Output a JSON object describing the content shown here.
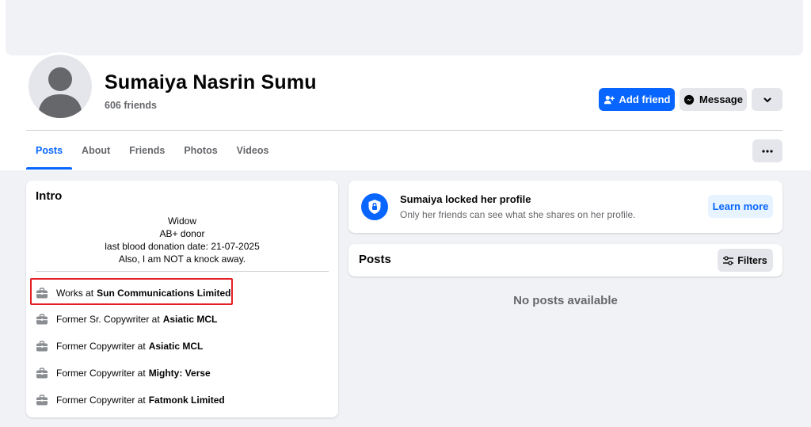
{
  "profile": {
    "name": "Sumaiya Nasrin Sumu",
    "friends": "606 friends"
  },
  "actions": {
    "add_friend": "Add friend",
    "message": "Message"
  },
  "tabs": [
    {
      "label": "Posts",
      "active": true
    },
    {
      "label": "About"
    },
    {
      "label": "Friends"
    },
    {
      "label": "Photos"
    },
    {
      "label": "Videos"
    }
  ],
  "intro": {
    "title": "Intro",
    "bio": [
      "Widow",
      "AB+ donor",
      "last blood donation date: 21-07-2025",
      "Also, I am NOT a knock away."
    ],
    "work": [
      {
        "prefix": "Works at",
        "org": "Sun Communications Limited"
      },
      {
        "prefix": "Former Sr. Copywriter at",
        "org": "Asiatic MCL"
      },
      {
        "prefix": "Former Copywriter at",
        "org": "Asiatic MCL"
      },
      {
        "prefix": "Former Copywriter at",
        "org": "Mighty: Verse"
      },
      {
        "prefix": "Former Copywriter at",
        "org": "Fatmonk Limited"
      }
    ]
  },
  "locked": {
    "title": "Sumaiya locked her profile",
    "subtitle": "Only her friends can see what she shares on her profile.",
    "learn_more": "Learn more"
  },
  "posts": {
    "title": "Posts",
    "filters": "Filters",
    "empty": "No posts available"
  },
  "colors": {
    "accent": "#0866ff",
    "highlight": "#e41e26"
  }
}
